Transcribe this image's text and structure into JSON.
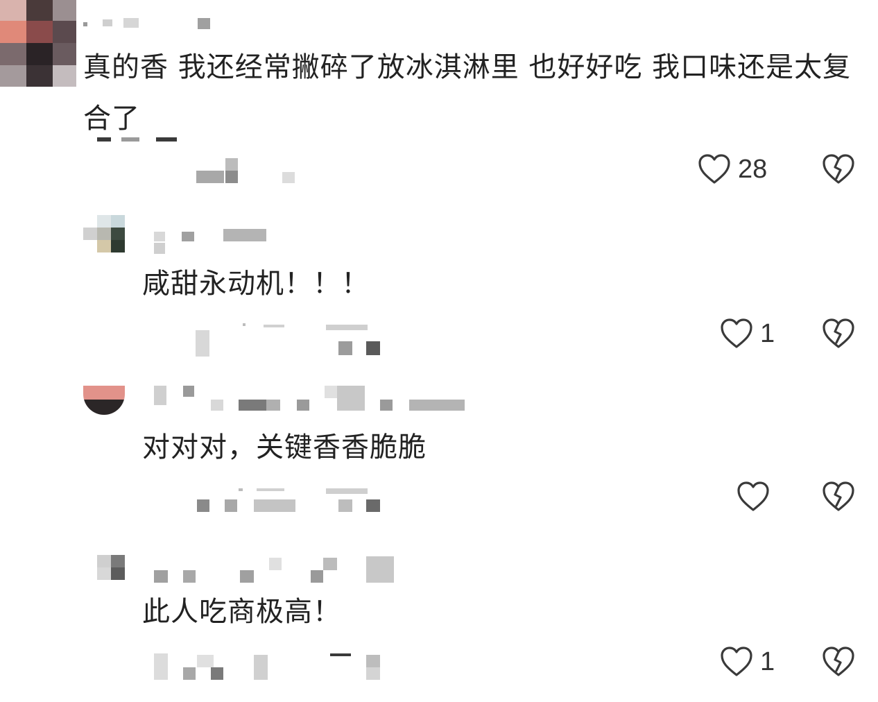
{
  "comments": [
    {
      "text": "真的香 我还经常撇碎了放冰淇淋里 也好好吃 我口味还是太复合了",
      "likes": "28"
    },
    {
      "text": "咸甜永动机！！！",
      "likes": "1"
    },
    {
      "text": "对对对，关键香香脆脆",
      "likes": ""
    },
    {
      "text": "此人吃商极高！",
      "likes": "1"
    }
  ],
  "icons": {
    "like": "heart-outline-icon",
    "dislike": "broken-heart-icon"
  },
  "colors": {
    "text": "#222222",
    "icon": "#3a3a3a",
    "mosaic_dark": "#3c3c3c",
    "mosaic_mid": "#8a8a8a",
    "mosaic_light": "#cfcfcf"
  }
}
